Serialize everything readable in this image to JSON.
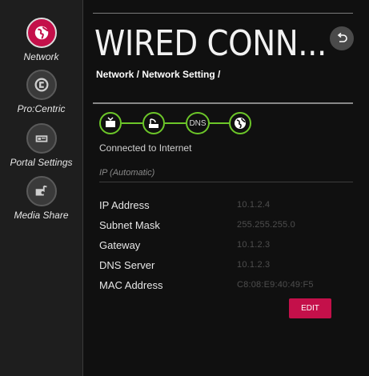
{
  "sidebar": {
    "items": [
      {
        "label": "Network",
        "icon": "globe-icon",
        "active": true
      },
      {
        "label": "Pro:Centric",
        "icon": "procentric-icon",
        "active": false
      },
      {
        "label": "Portal Settings",
        "icon": "portal-icon",
        "active": false
      },
      {
        "label": "Media Share",
        "icon": "media-share-icon",
        "active": false
      }
    ]
  },
  "header": {
    "title": "WIRED CONN...",
    "breadcrumb": "Network / Network Setting /",
    "back_icon": "back-arrow-icon"
  },
  "status": {
    "nodes": [
      "tv-icon",
      "router-icon",
      "DNS",
      "globe-icon"
    ],
    "dns_label": "DNS",
    "message": "Connected to Internet",
    "color": "#6cc629"
  },
  "ip_mode": "IP (Automatic)",
  "info": {
    "rows": [
      {
        "label": "IP Address",
        "value": "10.1.2.4"
      },
      {
        "label": "Subnet Mask",
        "value": "255.255.255.0"
      },
      {
        "label": "Gateway",
        "value": "10.1.2.3"
      },
      {
        "label": "DNS Server",
        "value": "10.1.2.3"
      },
      {
        "label": "MAC Address",
        "value": "C8:08:E9:40:49:F5"
      }
    ]
  },
  "edit_label": "EDIT",
  "colors": {
    "accent": "#c4104a",
    "status_green": "#6cc629"
  }
}
